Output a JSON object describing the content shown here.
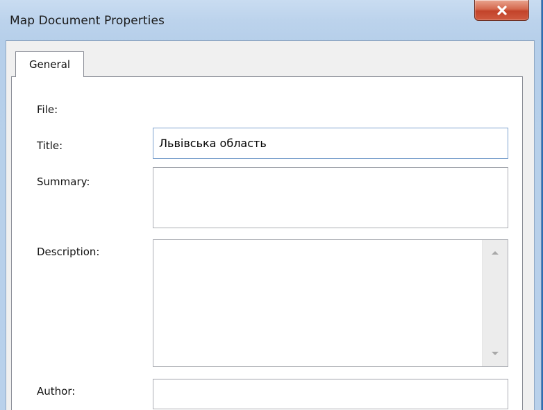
{
  "window": {
    "title": "Map Document Properties"
  },
  "tabs": [
    {
      "label": "General"
    }
  ],
  "form": {
    "file_label": "File:",
    "title_label": "Title:",
    "title_value": "Львівська область",
    "summary_label": "Summary:",
    "summary_value": "",
    "description_label": "Description:",
    "description_value": "",
    "author_label": "Author:",
    "author_value": ""
  },
  "colors": {
    "close_button": "#c9523a",
    "title_bar": "#bcd3ec",
    "focus_border": "#7da2ce"
  }
}
